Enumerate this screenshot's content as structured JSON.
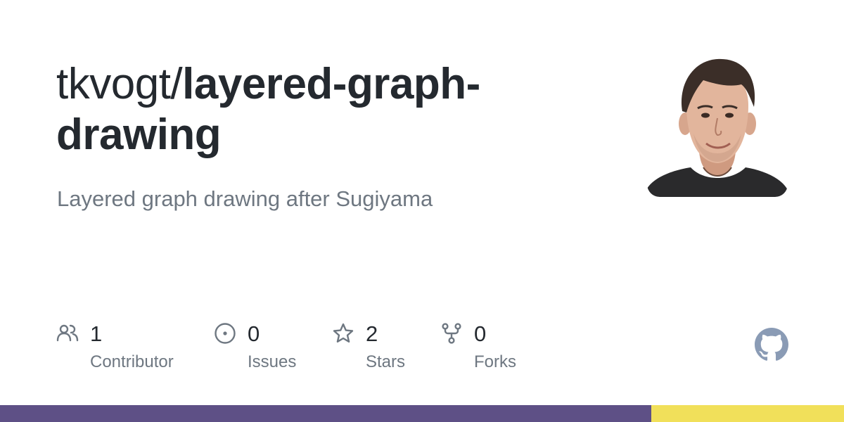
{
  "repo": {
    "owner": "tkvogt/",
    "name": "layered-graph-drawing",
    "description": "Layered graph drawing after Sugiyama"
  },
  "stats": {
    "contributors": {
      "count": "1",
      "label": "Contributor",
      "icon": "people-icon"
    },
    "issues": {
      "count": "0",
      "label": "Issues",
      "icon": "issue-opened-icon"
    },
    "stars": {
      "count": "2",
      "label": "Stars",
      "icon": "star-icon"
    },
    "forks": {
      "count": "0",
      "label": "Forks",
      "icon": "repo-forked-icon"
    }
  },
  "colors": {
    "icon": "#6e7781",
    "text": "#24292f",
    "muted": "#6e7781",
    "github_mark": "#8a9bb5"
  },
  "language_bar": [
    {
      "fraction": 0.772,
      "color": "#5e5086"
    },
    {
      "fraction": 0.228,
      "color": "#f1e05a"
    }
  ]
}
